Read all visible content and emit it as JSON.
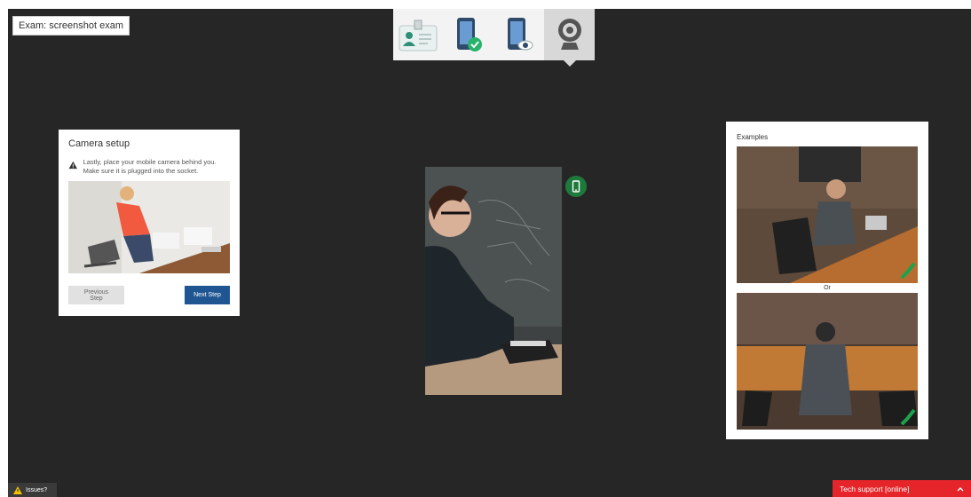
{
  "exam": {
    "label": "Exam: screenshot exam"
  },
  "steps": [
    {
      "name": "id-card-icon",
      "active": false
    },
    {
      "name": "mobile-check-icon",
      "active": false
    },
    {
      "name": "mobile-eye-icon",
      "active": false
    },
    {
      "name": "webcam-icon",
      "active": true
    }
  ],
  "setup": {
    "title": "Camera setup",
    "instruction": "Lastly, place your mobile camera behind you. Make sure it is plugged into the socket.",
    "prev_label": "Previous Step",
    "next_label": "Next Step"
  },
  "examples": {
    "title": "Examples",
    "or_label": "Or"
  },
  "footer": {
    "issues_label": "Issues?",
    "tech_label": "Tech support [online]"
  },
  "colors": {
    "stage": "#262626",
    "next_button": "#1f5591",
    "tech_support": "#e5252a",
    "mobile_badge": "#1e7a3c"
  }
}
